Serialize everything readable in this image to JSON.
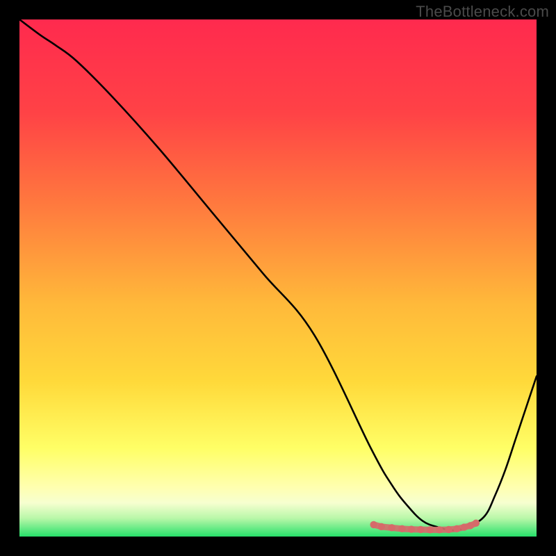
{
  "watermark": "TheBottleneck.com",
  "chart_data": {
    "type": "line",
    "title": "",
    "xlabel": "",
    "ylabel": "",
    "xlim": [
      0,
      100
    ],
    "ylim": [
      0,
      100
    ],
    "grid": false,
    "legend": false,
    "gradient_colors": {
      "top": "#ff2a4e",
      "mid_upper": "#ff7a3e",
      "mid": "#ffd93a",
      "mid_lower": "#ffff66",
      "bottom_band_top": "#f6ffd0",
      "bottom": "#27e06a"
    },
    "series": [
      {
        "name": "bottleneck-curve",
        "color": "#000000",
        "x": [
          0,
          4,
          7,
          11,
          18,
          27,
          37,
          47,
          57,
          68,
          72,
          75,
          78,
          81,
          84,
          87,
          90,
          92,
          94,
          96,
          98,
          100
        ],
        "values": [
          100,
          97,
          95,
          92,
          85,
          75,
          63,
          51,
          39,
          17,
          10,
          6,
          3,
          1.8,
          1.2,
          2.0,
          4,
          8,
          13,
          19,
          25,
          31
        ]
      },
      {
        "name": "highlight-dots",
        "color": "#d66a6a",
        "x": [
          68.5,
          70.0,
          72.0,
          74.0,
          75.8,
          77.6,
          79.4,
          81.2,
          83.0,
          84.6,
          86.0,
          87.2,
          88.3
        ],
        "values": [
          2.3,
          1.9,
          1.7,
          1.5,
          1.4,
          1.35,
          1.3,
          1.3,
          1.35,
          1.5,
          1.8,
          2.1,
          2.6
        ]
      }
    ]
  }
}
